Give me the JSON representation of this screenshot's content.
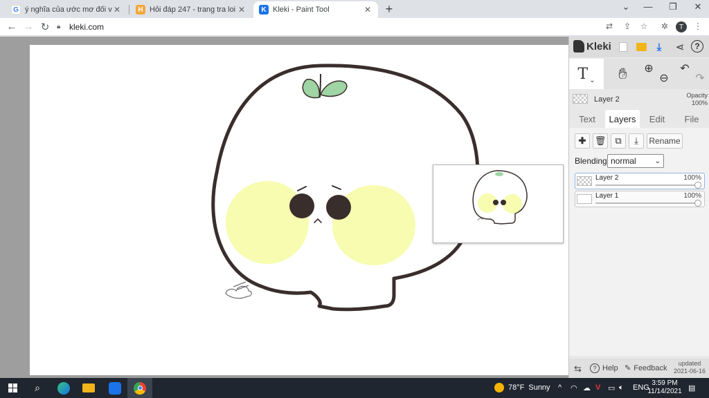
{
  "browser": {
    "tabs": [
      {
        "title": "ý nghĩa của ước mơ đối với mỗi",
        "favicon": "google-icon",
        "close": "✕"
      },
      {
        "title": "Hỏi đáp 247 - trang tra loi",
        "favicon": "hoidap-icon",
        "close": "✕"
      },
      {
        "title": "Kleki - Paint Tool",
        "favicon": "kleki-icon",
        "close": "✕"
      }
    ],
    "new_tab": "+",
    "url": "kleki.com"
  },
  "kleki": {
    "logo_text": "Kleki",
    "layer_name": "Layer 2",
    "opacity_label": "Opacity",
    "opacity_value": "100%",
    "tabs": [
      "Text",
      "Layers",
      "Edit",
      "File"
    ],
    "active_tab": "Layers",
    "rename_label": "Rename",
    "blending_label": "Blending",
    "blending_value": "normal",
    "layers": [
      {
        "name": "Layer 2",
        "opacity": "100%",
        "opacity_level": 1.0,
        "selected": true
      },
      {
        "name": "Layer 1",
        "opacity": "100%",
        "opacity_level": 1.0,
        "selected": false
      }
    ],
    "footer": {
      "help": "Help",
      "feedback": "Feedback",
      "updated_label": "updated",
      "updated_date": "2021-06-16"
    },
    "colors": {
      "download_accent": "#1a73e8",
      "folder": "#f2b41b",
      "leaf": "#9fd4a4",
      "cheek": "#f7fcb0",
      "outline": "#3a2e2c"
    }
  },
  "taskbar": {
    "weather_temp": "78°F",
    "weather_text": "Sunny",
    "lang": "ENG",
    "time": "3:59 PM",
    "date": "11/14/2021"
  }
}
